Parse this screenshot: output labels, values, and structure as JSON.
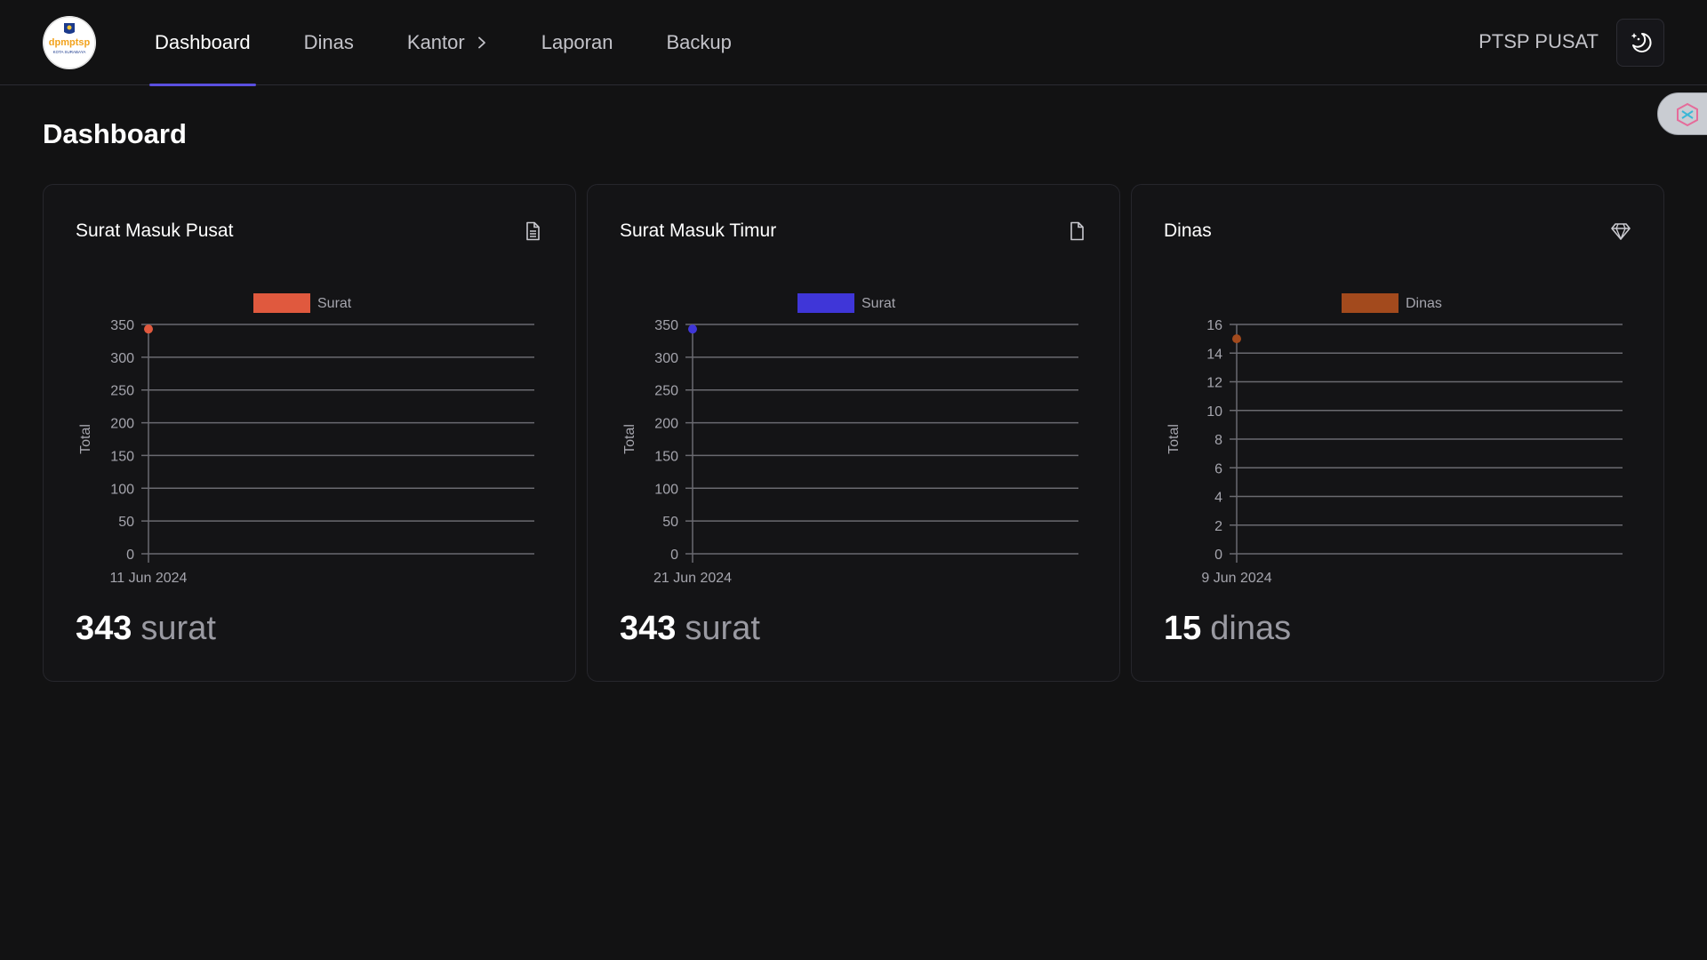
{
  "logo": {
    "text": "dpmptsp",
    "subtext": "KOTA SURABAYA"
  },
  "nav": {
    "items": [
      {
        "label": "Dashboard",
        "active": true
      },
      {
        "label": "Dinas",
        "active": false
      },
      {
        "label": "Kantor",
        "active": false,
        "has_submenu": true
      },
      {
        "label": "Laporan",
        "active": false
      },
      {
        "label": "Backup",
        "active": false
      }
    ]
  },
  "user": {
    "name": "PTSP PUSAT"
  },
  "theme_toggle": {
    "icon": "moon-stars-icon"
  },
  "page": {
    "title": "Dashboard"
  },
  "cards": [
    {
      "title": "Surat Masuk Pusat",
      "icon": "document-lines-icon",
      "total_value": "343",
      "total_unit": "surat"
    },
    {
      "title": "Surat Masuk Timur",
      "icon": "document-icon",
      "total_value": "343",
      "total_unit": "surat"
    },
    {
      "title": "Dinas",
      "icon": "diamond-icon",
      "total_value": "15",
      "total_unit": "dinas"
    }
  ],
  "chart_data": [
    {
      "type": "line",
      "legend": "Surat",
      "color": "#e0593e",
      "ylabel": "Total",
      "ylim": [
        0,
        350
      ],
      "yticks": [
        0,
        50,
        100,
        150,
        200,
        250,
        300,
        350
      ],
      "x": [
        "11 Jun 2024"
      ],
      "series": [
        {
          "name": "Surat",
          "values": [
            343
          ]
        }
      ],
      "legend_position": "top-center",
      "grid": true
    },
    {
      "type": "line",
      "legend": "Surat",
      "color": "#3f36d8",
      "ylabel": "Total",
      "ylim": [
        0,
        350
      ],
      "yticks": [
        0,
        50,
        100,
        150,
        200,
        250,
        300,
        350
      ],
      "x": [
        "21 Jun 2024"
      ],
      "series": [
        {
          "name": "Surat",
          "values": [
            343
          ]
        }
      ],
      "legend_position": "top-center",
      "grid": true
    },
    {
      "type": "line",
      "legend": "Dinas",
      "color": "#a34a1d",
      "ylabel": "Total",
      "ylim": [
        0,
        16
      ],
      "yticks": [
        0,
        2,
        4,
        6,
        8,
        10,
        12,
        14,
        16
      ],
      "x": [
        "9 Jun 2024"
      ],
      "series": [
        {
          "name": "Dinas",
          "values": [
            15
          ]
        }
      ],
      "legend_position": "top-center",
      "grid": true
    }
  ]
}
